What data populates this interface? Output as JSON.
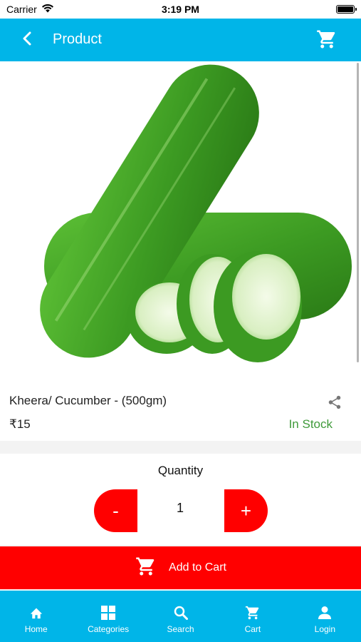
{
  "status_bar": {
    "carrier": "Carrier",
    "time": "3:19 PM"
  },
  "app_bar": {
    "title": "Product"
  },
  "product": {
    "name": "Kheera/ Cucumber -  (500gm)",
    "price": "₹15",
    "stock": "In Stock"
  },
  "quantity": {
    "label": "Quantity",
    "minus": "-",
    "value": "1",
    "plus": "+"
  },
  "add_to_cart": {
    "label": "Add to Cart"
  },
  "nav": {
    "items": [
      {
        "label": "Home",
        "icon": "home-icon"
      },
      {
        "label": "Categories",
        "icon": "grid-icon"
      },
      {
        "label": "Search",
        "icon": "search-icon"
      },
      {
        "label": "Cart",
        "icon": "cart-icon"
      },
      {
        "label": "Login",
        "icon": "person-icon"
      }
    ]
  },
  "colors": {
    "primary": "#00b5e8",
    "action": "#ff0000",
    "in_stock": "#3f9a3a"
  }
}
